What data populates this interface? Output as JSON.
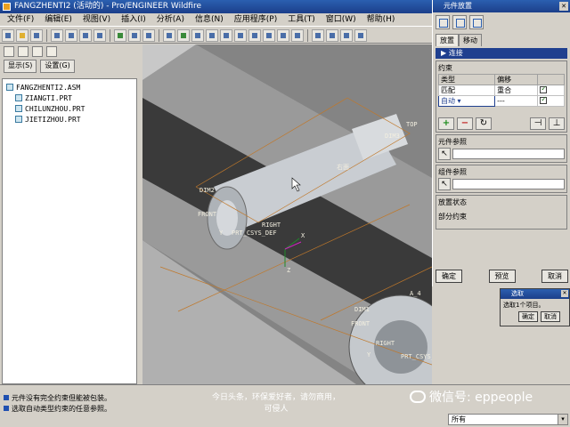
{
  "window": {
    "title": "FANGZHENTI2 (活动的) - Pro/ENGINEER Wildfire"
  },
  "menu": [
    "文件(F)",
    "编辑(E)",
    "视图(V)",
    "插入(I)",
    "分析(A)",
    "信息(N)",
    "应用程序(P)",
    "工具(T)",
    "窗口(W)",
    "帮助(H)"
  ],
  "left_panel": {
    "show_label": "显示(S)",
    "settings_label": "设置(G)",
    "tree": {
      "root": "FANGZHENTI2.ASM",
      "children": [
        "ZIANGTI.PRT",
        "CHILUNZHOU.PRT",
        "JIETIZHOU.PRT"
      ]
    }
  },
  "viewport": {
    "labels": [
      "DIM3",
      "TOP",
      "右面",
      "DIM2",
      "FRONT",
      "RIGHT",
      "PRT_CSYS_DEF",
      "DIM1",
      "FRONT",
      "RIGHT",
      "PRT_CSYS_DEF",
      "A_4",
      "X",
      "Y",
      "Y",
      "Z"
    ]
  },
  "dialog": {
    "title": "元件放置",
    "tabs": [
      "放置",
      "移动"
    ],
    "connection_header": "连接",
    "constraints": {
      "label": "约束",
      "columns": [
        "类型",
        "偏移"
      ],
      "rows": [
        {
          "type": "匹配",
          "offset": "重合"
        },
        {
          "type": "自动",
          "offset": "---"
        }
      ]
    },
    "component_ref_label": "元件参照",
    "assembly_ref_label": "组件参照",
    "placement_status_label": "放置状态",
    "placement_status_value": "部分约束",
    "ok": "确定",
    "preview": "预览",
    "cancel": "取消"
  },
  "select_dialog": {
    "title": "选取",
    "message": "选取1个项目。",
    "ok": "确定",
    "cancel": "取消"
  },
  "status": {
    "messages": [
      "元件没有完全约束但能被包装。",
      "选取自动类型约束的任意参照。"
    ],
    "filter": "所有"
  },
  "watermark": {
    "line1": "今日头条，环保爱好者，请勿商用，",
    "line2": "可侵人",
    "wechat": "微信号: eppeople"
  },
  "colors": {
    "title_bar": "#1c3f8a",
    "accent": "#1f3f8f",
    "viewport": "#848484"
  }
}
